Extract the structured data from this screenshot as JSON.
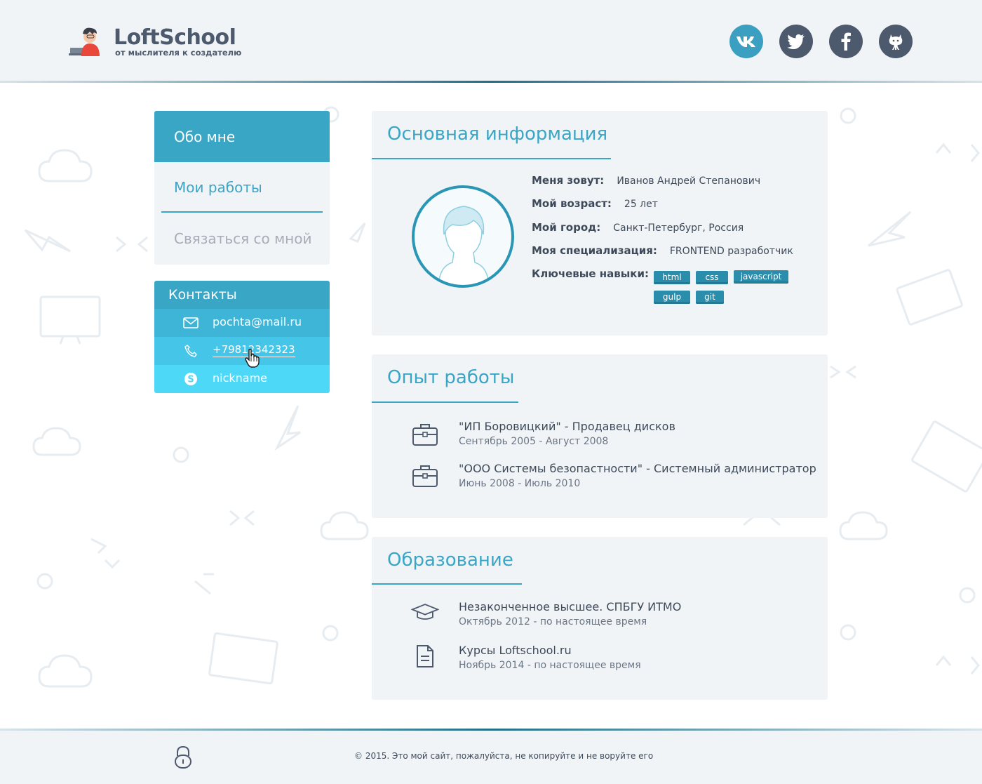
{
  "brand": {
    "name": "LoftSchool",
    "tagline": "от мыслителя к создателю"
  },
  "social": [
    {
      "name": "vk",
      "icon": "vk-icon"
    },
    {
      "name": "twitter",
      "icon": "twitter-icon"
    },
    {
      "name": "facebook",
      "icon": "facebook-icon"
    },
    {
      "name": "github",
      "icon": "github-icon"
    }
  ],
  "nav": {
    "items": [
      {
        "label": "Обо мне",
        "active": true
      },
      {
        "label": "Мои работы",
        "active": false
      },
      {
        "label": "Связаться со мной",
        "active": false
      }
    ]
  },
  "contacts": {
    "title": "Контакты",
    "email": "pochta@mail.ru",
    "phone": "+79812342323",
    "skype": "nickname"
  },
  "basic_info": {
    "title": "Основная информация",
    "rows": [
      {
        "label": "Меня зовут:",
        "value": "Иванов Андрей Степанович"
      },
      {
        "label": "Мой возраст:",
        "value": "25 лет"
      },
      {
        "label": "Мой город:",
        "value": "Санкт-Петербург, Россия"
      },
      {
        "label": "Моя специализация:",
        "value": "FRONTEND разработчик"
      },
      {
        "label": "Ключевые навыки:",
        "value": ""
      }
    ],
    "skills": [
      "html",
      "css",
      "javascript",
      "gulp",
      "git"
    ]
  },
  "experience": {
    "title": "Опыт работы",
    "items": [
      {
        "title": "\"ИП Боровицкий\" - Продавец дисков",
        "dates": "Сентябрь 2005 - Август 2008"
      },
      {
        "title": "\"ООО Системы безопастности\" - Системный администратор",
        "dates": "Июнь 2008 - Июль 2010"
      }
    ]
  },
  "education": {
    "title": "Образование",
    "items": [
      {
        "title": "Незаконченное высшее. СПБГУ ИТМО",
        "dates": "Октябрь 2012 - по настоящее время"
      },
      {
        "title": "Курсы Loftschool.ru",
        "dates": "Ноябрь 2014 - по настоящее время"
      }
    ]
  },
  "footer": {
    "copyright": "© 2015. Это мой сайт, пожалуйста, не копируйте и не воруйте его"
  },
  "colors": {
    "accent": "#3aa6c6",
    "dark": "#4d5a6d",
    "panel": "#f1f4f7"
  }
}
